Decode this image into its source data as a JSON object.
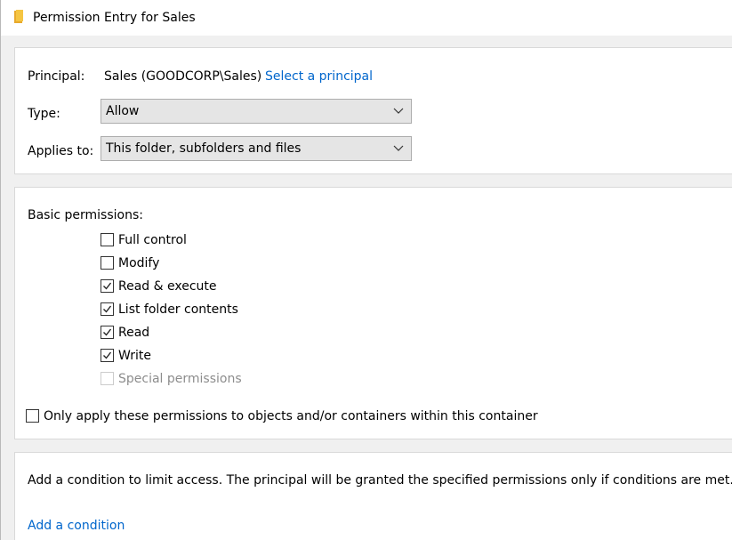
{
  "window": {
    "title": "Permission Entry for Sales",
    "icon": "folder-icon"
  },
  "principal": {
    "label": "Principal:",
    "value": "Sales (GOODCORP\\Sales)",
    "link": "Select a principal"
  },
  "type": {
    "label": "Type:",
    "selected": "Allow"
  },
  "applies_to": {
    "label": "Applies to:",
    "selected": "This folder, subfolders and files"
  },
  "basic_permissions": {
    "heading": "Basic permissions:",
    "items": [
      {
        "label": "Full control",
        "checked": false,
        "disabled": false
      },
      {
        "label": "Modify",
        "checked": false,
        "disabled": false
      },
      {
        "label": "Read & execute",
        "checked": true,
        "disabled": false
      },
      {
        "label": "List folder contents",
        "checked": true,
        "disabled": false
      },
      {
        "label": "Read",
        "checked": true,
        "disabled": false
      },
      {
        "label": "Write",
        "checked": true,
        "disabled": false
      },
      {
        "label": "Special permissions",
        "checked": false,
        "disabled": true
      }
    ]
  },
  "only_apply": {
    "label": "Only apply these permissions to objects and/or containers within this container",
    "checked": false
  },
  "condition": {
    "description": "Add a condition to limit access. The principal will be granted the specified permissions only if conditions are met.",
    "link": "Add a condition"
  },
  "colors": {
    "link": "#0066cc",
    "folder": "#f5c542"
  }
}
